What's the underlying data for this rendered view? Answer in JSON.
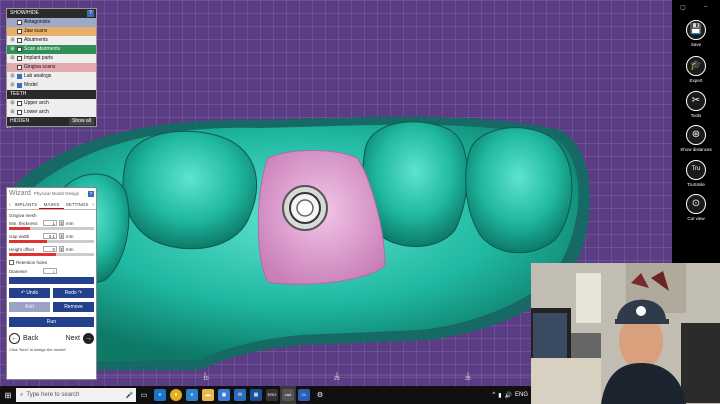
{
  "tree": {
    "show_hide_label": "SHOW/HIDE",
    "help_label": "?",
    "items": [
      {
        "label": "Antagonists",
        "checked": false
      },
      {
        "label": "Jaw scans",
        "checked": false
      },
      {
        "label": "Abutments",
        "checked": false
      },
      {
        "label": "Scan abutments",
        "checked": false
      },
      {
        "label": "Implant parts",
        "checked": false
      },
      {
        "label": "Gingiva scans",
        "checked": false
      },
      {
        "label": "Lab analogs",
        "checked": true
      },
      {
        "label": "Model",
        "checked": true
      }
    ],
    "teeth_label": "TEETH",
    "teeth_items": [
      {
        "label": "Upper arch",
        "checked": false
      },
      {
        "label": "Lower arch",
        "checked": false
      }
    ],
    "hidden_label": "HIDDEN",
    "show_all_label": "Show all"
  },
  "wizard": {
    "title": "Wizard",
    "subtitle": "Physical Model Design",
    "help_label": "?",
    "tabs": [
      "IMPLANTS",
      "MASKS",
      "SETTINGS"
    ],
    "section_title": "Gingiva mesh",
    "params": [
      {
        "label": "Min. thickness",
        "value": "1",
        "unit": "mm",
        "level": 0.25
      },
      {
        "label": "Gap width",
        "value": "0.1",
        "unit": "mm",
        "level": 0.45
      },
      {
        "label": "Height offset",
        "value": "0",
        "unit": "mm",
        "level": 0.55
      }
    ],
    "retention_label": "Retention holes",
    "diameter_label": "Diameter",
    "diameter_value": "1",
    "undo_label": "Undo",
    "redo_label": "Redo",
    "add_label": "Add",
    "remove_label": "Remove",
    "run_label": "Run",
    "back_label": "Back",
    "next_label": "Next",
    "hint": "Click 'Next' to design the model!"
  },
  "toolbar": {
    "items": [
      {
        "label": "Save",
        "icon": "save-icon",
        "glyph": "💾"
      },
      {
        "label": "Expert",
        "icon": "expert-icon",
        "glyph": "🎓"
      },
      {
        "label": "Tools",
        "icon": "tools-icon",
        "glyph": "✂"
      },
      {
        "label": "Show distances",
        "icon": "distances-icon",
        "glyph": "⊛"
      },
      {
        "label": "TruSmile",
        "icon": "trusmile-icon",
        "glyph": "Tru"
      },
      {
        "label": "Cut view",
        "icon": "cut-view-icon",
        "glyph": "⊙"
      }
    ]
  },
  "scale": {
    "ticks": [
      "10",
      "20",
      "30"
    ],
    "side_tick": "15"
  },
  "taskbar": {
    "search_placeholder": "Type here to search",
    "apps": [
      "ERO",
      "cad",
      "CL"
    ],
    "tray_text": "ENG"
  },
  "colors": {
    "viewport_bg": "#5a3d84",
    "model_teal": "#1fb8a0",
    "gingiva_pink": "#e7a6d6",
    "wizard_blue": "#23408e"
  }
}
